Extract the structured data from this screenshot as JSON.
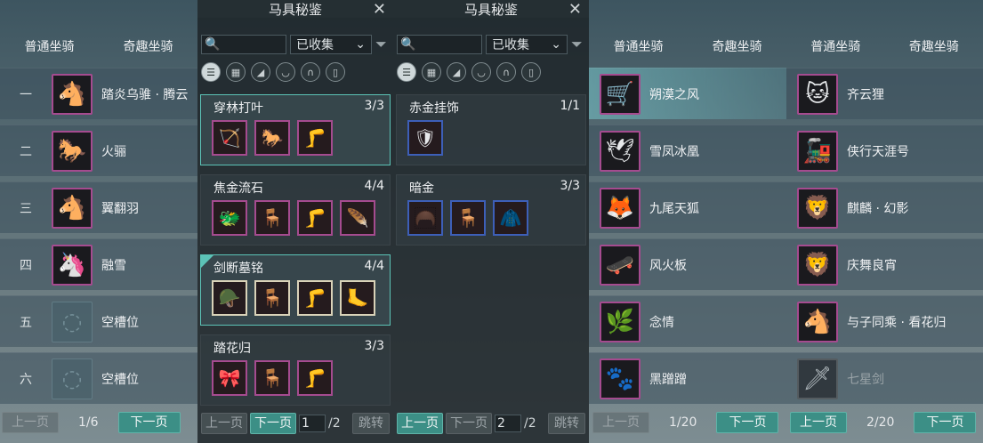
{
  "panel1": {
    "tabs": [
      "普通坐骑",
      "奇趣坐骑"
    ],
    "rows": [
      {
        "num": "一",
        "name": "踏炎乌骓 · 腾云",
        "icon": "🐴"
      },
      {
        "num": "二",
        "name": "火骊",
        "icon": "🐎"
      },
      {
        "num": "三",
        "name": "翼翻羽",
        "icon": "🐴"
      },
      {
        "num": "四",
        "name": "融雪",
        "icon": "🦄"
      },
      {
        "num": "五",
        "name": "空槽位",
        "icon": ""
      },
      {
        "num": "六",
        "name": "空槽位",
        "icon": ""
      }
    ],
    "pager": {
      "prev": "上一页",
      "page": "1/6",
      "next": "下一页"
    }
  },
  "codex_a": {
    "title": "马具秘鉴",
    "filter_value": "已收集",
    "sets": [
      {
        "name": "穿林打叶",
        "count": "3/3",
        "items": [
          "🏹",
          "🐎",
          "🦵"
        ]
      },
      {
        "name": "焦金流石",
        "count": "4/4",
        "items": [
          "🐲",
          "🪑",
          "🦵",
          "🪶"
        ]
      },
      {
        "name": "剑断墓铭",
        "count": "4/4",
        "items": [
          "🪖",
          "🪑",
          "🦵",
          "🦶"
        ]
      },
      {
        "name": "踏花归",
        "count": "3/3",
        "items": [
          "🎀",
          "🪑",
          "🦵"
        ]
      }
    ],
    "pager": {
      "prev": "上一页",
      "next": "下一页",
      "page_input": "1",
      "total": "/2",
      "jump": "跳转"
    }
  },
  "codex_b": {
    "title": "马具秘鉴",
    "filter_value": "已收集",
    "sets": [
      {
        "name": "赤金挂饰",
        "count": "1/1",
        "items": [
          "🛡"
        ]
      },
      {
        "name": "暗金",
        "count": "3/3",
        "items": [
          "🦱",
          "🪑",
          "🧥"
        ]
      }
    ],
    "pager": {
      "prev": "上一页",
      "next": "下一页",
      "page_input": "2",
      "total": "/2",
      "jump": "跳转"
    }
  },
  "panel4": {
    "tabs": [
      "普通坐骑",
      "奇趣坐骑"
    ],
    "rows": [
      {
        "name": "朔漠之风",
        "icon": "🛒"
      },
      {
        "name": "雪凤冰凰",
        "icon": "🕊"
      },
      {
        "name": "九尾天狐",
        "icon": "🦊"
      },
      {
        "name": "风火板",
        "icon": "🛹"
      },
      {
        "name": "念情",
        "icon": "🌿"
      },
      {
        "name": "黑蹭蹭",
        "icon": "🐾"
      }
    ],
    "pager": {
      "prev": "上一页",
      "page": "1/20",
      "next": "下一页"
    }
  },
  "panel5": {
    "tabs": [
      "普通坐骑",
      "奇趣坐骑"
    ],
    "rows": [
      {
        "name": "齐云狸",
        "icon": "🐱"
      },
      {
        "name": "侠行天涯号",
        "icon": "🚂"
      },
      {
        "name": "麒麟 · 幻影",
        "icon": "🦁"
      },
      {
        "name": "庆舞良宵",
        "icon": "🦁"
      },
      {
        "name": "与子同乘 · 看花归",
        "icon": "🐴"
      },
      {
        "name": "七星剑",
        "icon": "🗡"
      }
    ],
    "pager": {
      "prev": "上一页",
      "page": "2/20",
      "next": "下一页"
    }
  }
}
